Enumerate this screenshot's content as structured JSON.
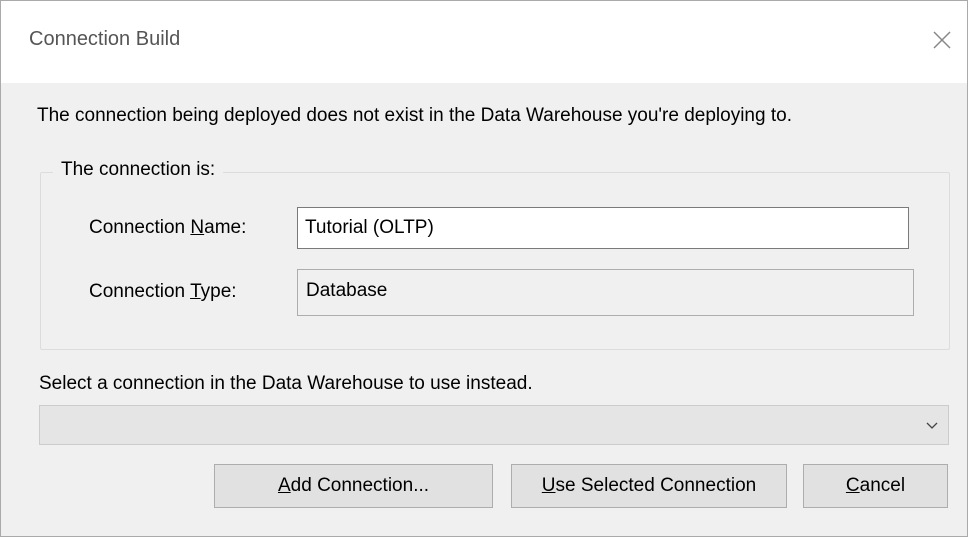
{
  "window": {
    "title": "Connection Build"
  },
  "message": "The connection being deployed does not exist in the Data Warehouse you're deploying to.",
  "group": {
    "legend": "The connection is:",
    "name_label_pre": "Connection ",
    "name_label_key": "N",
    "name_label_post": "ame:",
    "name_value": "Tutorial (OLTP)",
    "type_label_pre": "Connection ",
    "type_label_key": "T",
    "type_label_post": "ype:",
    "type_value": "Database"
  },
  "select": {
    "label": "Select a connection in the Data Warehouse to use instead.",
    "value": ""
  },
  "buttons": {
    "add_key": "A",
    "add_rest": "dd Connection...",
    "use_key": "U",
    "use_rest": "se Selected Connection",
    "cancel_key": "C",
    "cancel_rest": "ancel"
  },
  "icons": {
    "close": "close-icon",
    "dropdown": "chevron-down-icon"
  }
}
